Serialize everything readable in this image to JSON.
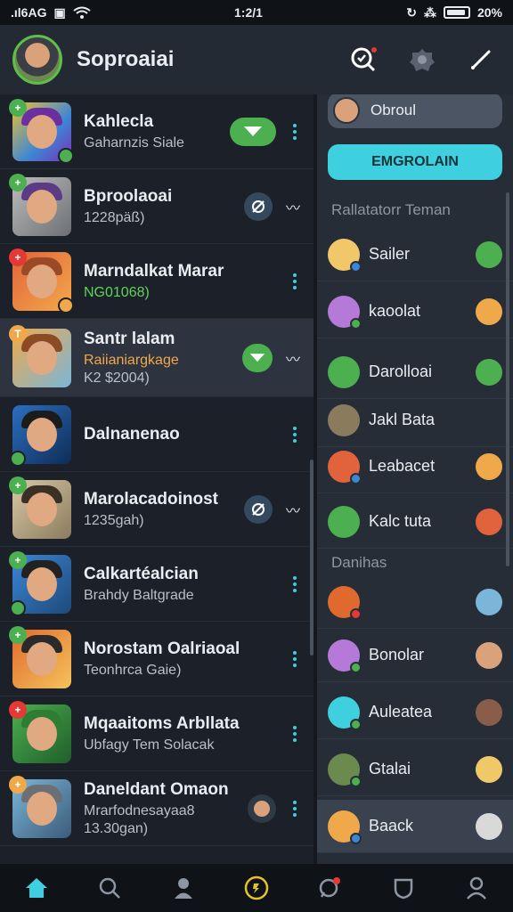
{
  "status_bar": {
    "left_text": ".ıl6AG",
    "time": "1:2/1",
    "battery": "20%"
  },
  "header": {
    "title": "Soproaiai"
  },
  "chats": [
    {
      "name": "Kahlecla",
      "sub": "Gaharnzis Siale",
      "sub_style": "",
      "trail": "pill"
    },
    {
      "name": "Bproolaoai",
      "sub": "1228päß)",
      "sub_style": "",
      "trail": "circle-wave"
    },
    {
      "name": "Marndalkat Marar",
      "sub": "NG01068)",
      "sub_style": "green",
      "trail": "kebab"
    },
    {
      "name": "Santr lalam",
      "sub": "Raiianiargkage",
      "sub2": "K2 $2004)",
      "sub_style": "orange",
      "trail": "pill-wave"
    },
    {
      "name": "Dalnanenao",
      "sub": "",
      "sub_style": "",
      "trail": "kebab"
    },
    {
      "name": "Marolacadoinost",
      "sub": "1235gah)",
      "sub_style": "",
      "trail": "circle-wave"
    },
    {
      "name": "Calkartéalcian",
      "sub": "Brahdy Baltgrade",
      "sub_style": "",
      "trail": "kebab"
    },
    {
      "name": "Norostam Oalriaoal",
      "sub": "Teonhrca Gaie)",
      "sub_style": "",
      "trail": "kebab"
    },
    {
      "name": "Mqaaitoms Arbllata",
      "sub": "Ubfagy Tem Solacak",
      "sub_style": "",
      "trail": "kebab"
    },
    {
      "name": "Daneldant Omaon",
      "sub": "Mrarfodnesayaa8",
      "sub2": "13.30gan)",
      "sub_style": "",
      "trail": "avatar-kebab"
    }
  ],
  "right_panel": {
    "search_label": "Obroul",
    "cta_label": "EMGROLAIN",
    "section1_title": "Rallatatorr Teman",
    "section2_title": "Danihas",
    "contacts1": [
      "Sailer",
      "kaoolat",
      "Darolloai",
      "Jakl Bata",
      "Leabacet",
      "Kalc tuta"
    ],
    "contacts2": [
      "",
      "Bonolar",
      "Auleatea",
      "Gtalai",
      "Baack"
    ]
  },
  "colors": {
    "accent": "#3fd0e0",
    "green": "#4caf50",
    "orange": "#f0a94a"
  }
}
